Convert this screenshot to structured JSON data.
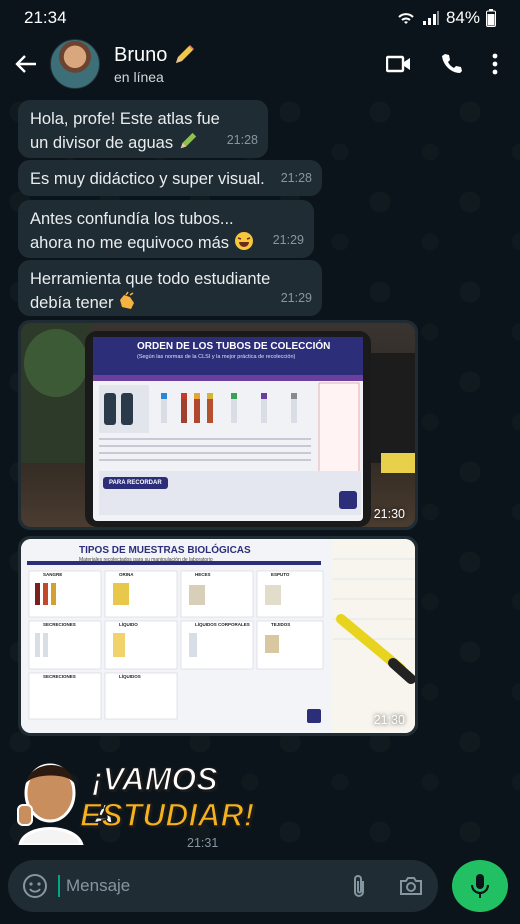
{
  "status_bar": {
    "time": "21:34",
    "battery": "84%"
  },
  "header": {
    "name": "Bruno",
    "status": "en línea"
  },
  "messages": [
    {
      "text_l1": "Hola, profe! Este atlas fue",
      "text_l2": "un divisor de aguas",
      "time": "21:28"
    },
    {
      "text": "Es muy didáctico y super visual.",
      "time": "21:28"
    },
    {
      "text_l1": "Antes confundía los tubos...",
      "text_l2": "ahora no me equivoco más",
      "time": "21:29"
    },
    {
      "text_l1": "Herramienta que todo estudiante",
      "text_l2": "debía tener",
      "time": "21:29"
    }
  ],
  "image1": {
    "title": "ORDEN DE LOS TUBOS DE COLECCIÓN",
    "subtitle": "(Según las normas de la CLSI y la mejor práctica de recolección)",
    "button": "PARA RECORDAR",
    "time": "21:30"
  },
  "image2": {
    "title": "TIPOS DE MUESTRAS BIOLÓGICAS",
    "subtitle": "Materiales recolectados para su manipulación de laboratorio",
    "sections": [
      "SANGRE",
      "ORINA",
      "HECES",
      "ESPUTO",
      "SECRECIONES",
      "LÍQUIDO",
      "LÍQUIDOS CORPORALES",
      "TEJIDOS",
      "SECRECIONES",
      "LÍQUIDOS"
    ],
    "time": "21:30"
  },
  "sticker": {
    "line1": "¡VAMOS A",
    "line2": "ESTUDIAR!",
    "time": "21:31"
  },
  "composer": {
    "placeholder": "Mensaje"
  }
}
